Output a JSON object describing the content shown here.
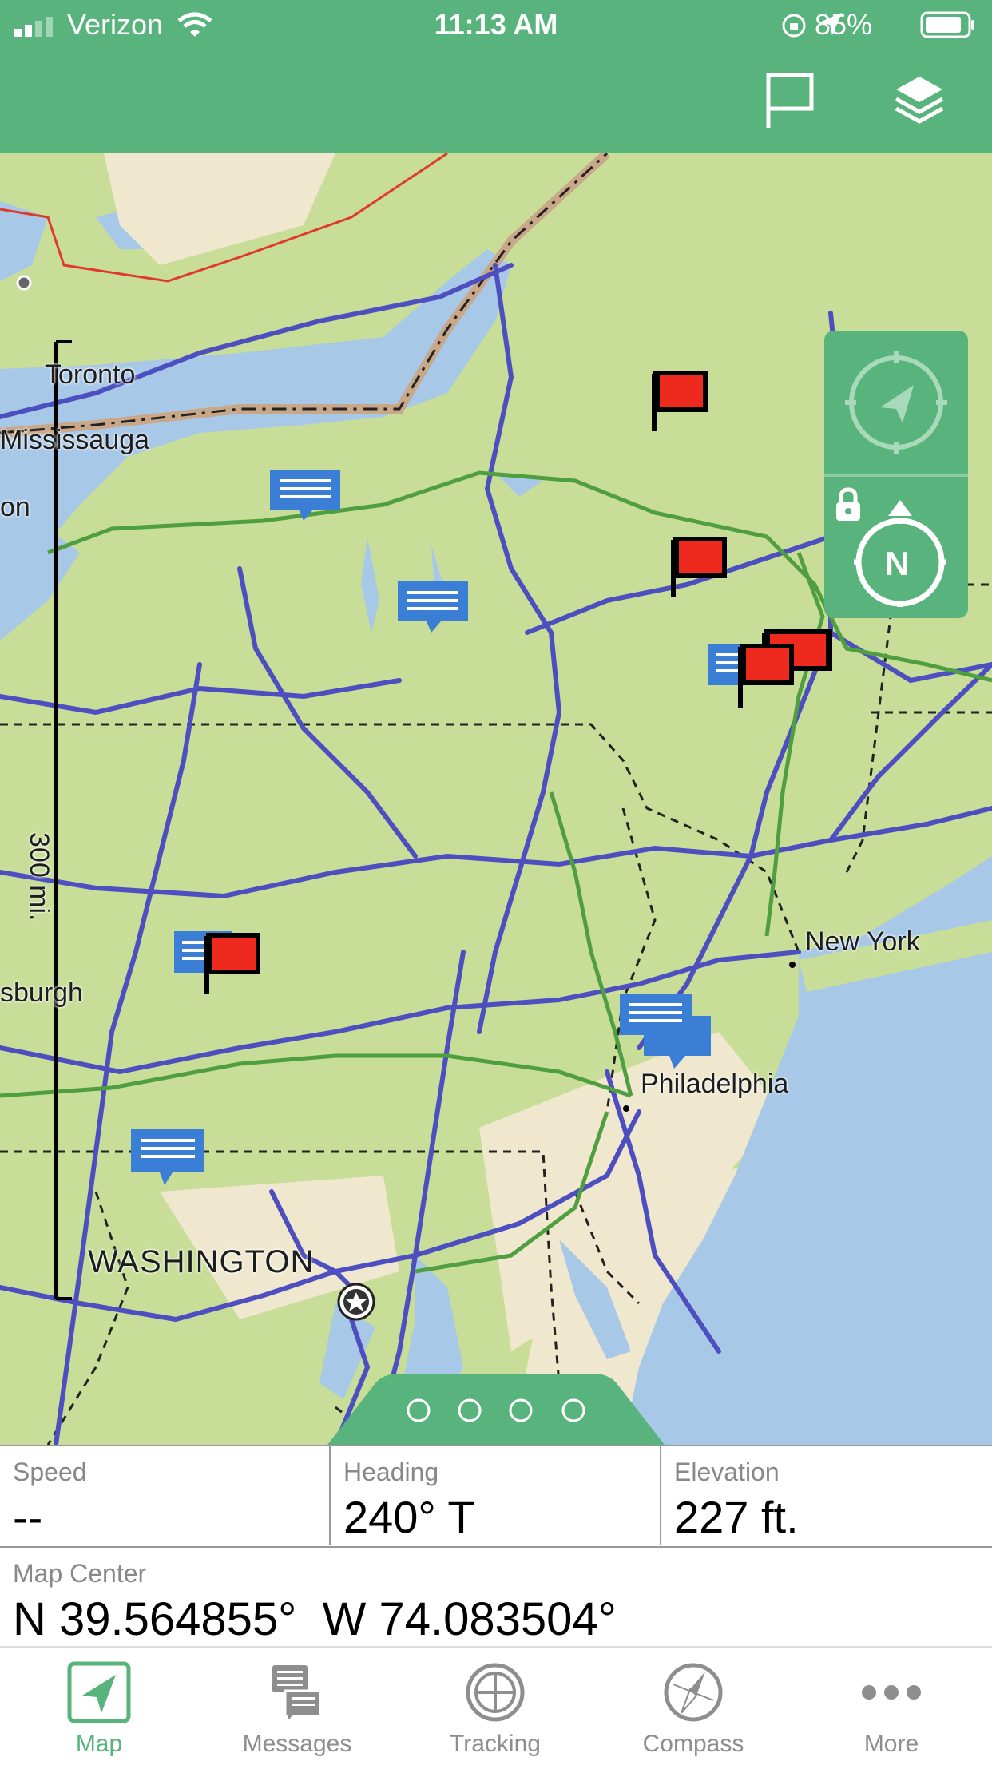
{
  "status_bar": {
    "carrier": "Verizon",
    "time": "11:13 AM",
    "battery": "85%"
  },
  "map": {
    "labels": {
      "toronto": "Toronto",
      "mississauga": "Mississauga",
      "on": "on",
      "sburgh": "sburgh",
      "new_york": "New York",
      "philadelphia": "Philadelphia",
      "washington": "WASHINGTON"
    },
    "scale": "300 mi.",
    "compass_letter": "N"
  },
  "info": {
    "speed_label": "Speed",
    "speed_value": "--",
    "heading_label": "Heading",
    "heading_value": "240° T",
    "elevation_label": "Elevation",
    "elevation_value": "227 ft.",
    "center_label": "Map Center",
    "center_value": "N 39.564855°  W 74.083504°"
  },
  "tabs": [
    {
      "label": "Map",
      "icon": "navigation-arrow-icon"
    },
    {
      "label": "Messages",
      "icon": "messages-icon"
    },
    {
      "label": "Tracking",
      "icon": "tracking-icon"
    },
    {
      "label": "Compass",
      "icon": "compass-icon"
    },
    {
      "label": "More",
      "icon": "more-dots-icon"
    }
  ],
  "colors": {
    "accent": "#58b37d",
    "water": "#a8c8e8",
    "land": "#c7dd98",
    "road": "#4d4fc0",
    "flag": "#ee2a1f",
    "message": "#3a7fd5"
  }
}
